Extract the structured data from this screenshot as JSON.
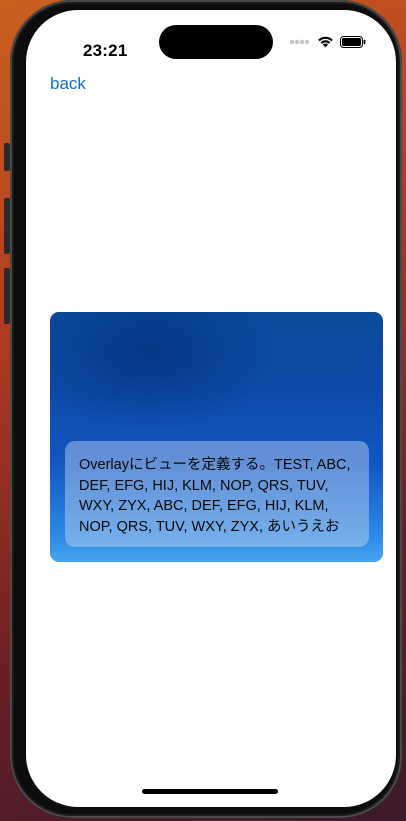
{
  "status_bar": {
    "time": "23:21",
    "icons": [
      "cellular-dots-icon",
      "wifi-icon",
      "battery-icon"
    ]
  },
  "nav": {
    "back_label": "back"
  },
  "card": {
    "overlay_text": "Overlayにビューを定義する。TEST, ABC, DEF, EFG, HIJ, KLM, NOP, QRS, TUV, WXY, ZYX, ABC, DEF, EFG, HIJ, KLM, NOP, QRS, TUV, WXY, ZYX, あいうえお"
  },
  "colors": {
    "link": "#0a6fd8",
    "card_top": "#0a4b9c",
    "card_bottom": "#47a6f0"
  }
}
